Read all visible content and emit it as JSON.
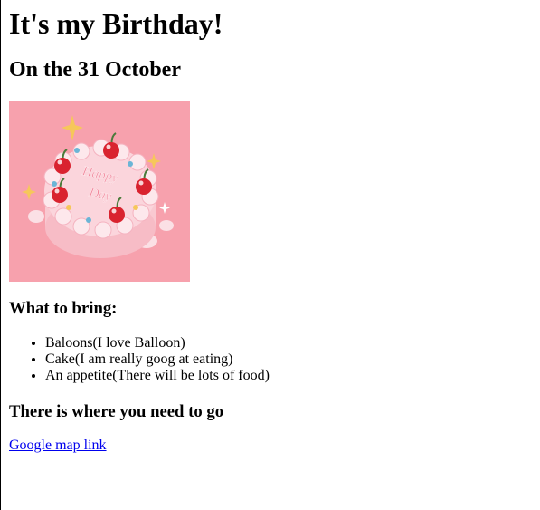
{
  "page": {
    "title": "It's my Birthday!",
    "subtitle": "On the 31 October"
  },
  "image": {
    "cake_text": "Happy Day",
    "background_color": "#f7a1ad"
  },
  "bring": {
    "heading": "What to bring:",
    "items": [
      "Baloons(I love Balloon)",
      "Cake(I am really goog at eating)",
      "An appetite(There will be lots of food)"
    ]
  },
  "location": {
    "heading": "There is where you need to go",
    "link_text": "Google map link",
    "link_color": "#0000ee"
  }
}
